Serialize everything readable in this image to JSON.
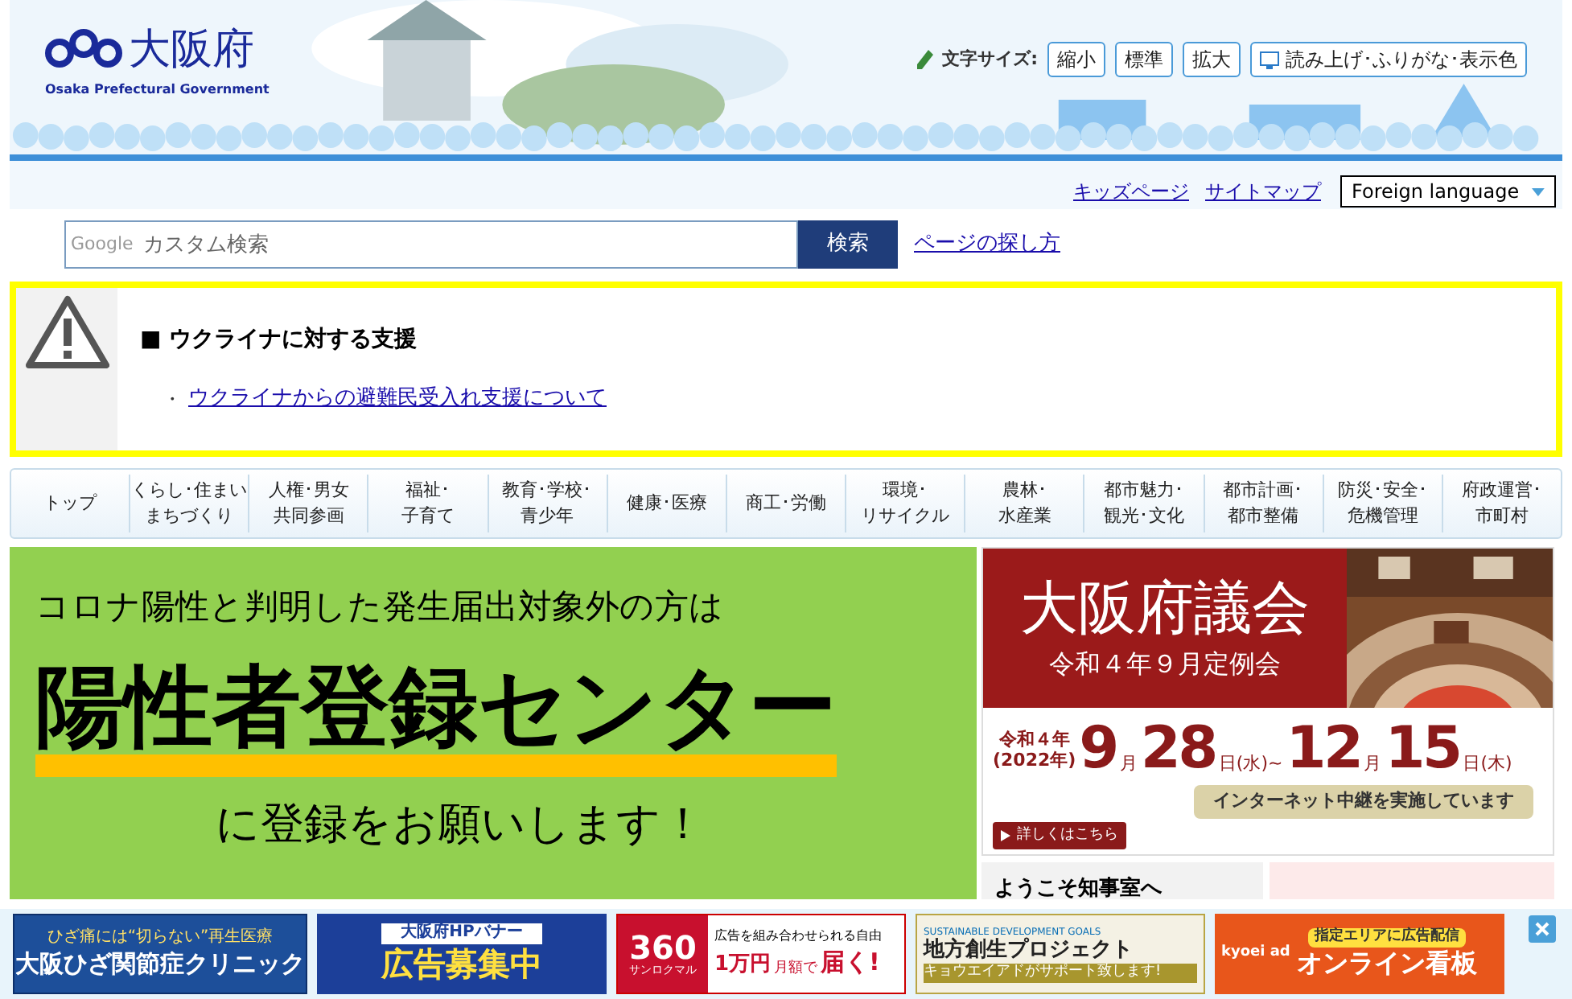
{
  "header": {
    "title": "大阪府",
    "subtitle": "Osaka Prefectural Government",
    "font_size_label": "文字サイズ:",
    "font_size_buttons": [
      "縮小",
      "標準",
      "拡大"
    ],
    "reader_button": "読み上げ･ふりがな･表示色"
  },
  "utility_links": [
    "キッズページ",
    "サイトマップ"
  ],
  "language_select": {
    "value": "Foreign language"
  },
  "search": {
    "brand": "Google",
    "placeholder": "カスタム検索",
    "button": "検索",
    "help_link": "ページの探し方"
  },
  "alert": {
    "title": "■ ウクライナに対する支援",
    "bullet": "・",
    "links": [
      "ウクライナからの避難民受入れ支援について"
    ]
  },
  "nav": [
    {
      "lines": [
        "トップ"
      ]
    },
    {
      "lines": [
        "くらし･住まい",
        "まちづくり"
      ]
    },
    {
      "lines": [
        "人権･男女",
        "共同参画"
      ]
    },
    {
      "lines": [
        "福祉･",
        "子育て"
      ]
    },
    {
      "lines": [
        "教育･学校･",
        "青少年"
      ]
    },
    {
      "lines": [
        "健康･医療"
      ]
    },
    {
      "lines": [
        "商工･労働"
      ]
    },
    {
      "lines": [
        "環境･",
        "リサイクル"
      ]
    },
    {
      "lines": [
        "農林･",
        "水産業"
      ]
    },
    {
      "lines": [
        "都市魅力･",
        "観光･文化"
      ]
    },
    {
      "lines": [
        "都市計画･",
        "都市整備"
      ]
    },
    {
      "lines": [
        "防災･安全･",
        "危機管理"
      ]
    },
    {
      "lines": [
        "府政運営･",
        "市町村"
      ]
    }
  ],
  "covid_banner": {
    "lines": [
      "コロナ陽性と判明した発生届出対象外の方は",
      "陽性者登録センター",
      "に登録をお願いします！"
    ]
  },
  "assembly_banner": {
    "title": "大阪府議会",
    "subtitle": "令和４年９月定例会",
    "era": "令和４年",
    "year": "(2022年)",
    "date_parts": [
      {
        "text": "9",
        "kind": "big"
      },
      {
        "text": "月",
        "kind": "small"
      },
      {
        "text": "28",
        "kind": "big"
      },
      {
        "text": "日(水)~",
        "kind": "small"
      },
      {
        "text": "12",
        "kind": "big"
      },
      {
        "text": "月",
        "kind": "small"
      },
      {
        "text": "15",
        "kind": "big"
      },
      {
        "text": "日(木)",
        "kind": "small"
      }
    ],
    "notice": "インターネット中継を実施しています",
    "details_button": "詳しくはこちら"
  },
  "governor_box": {
    "title": "ようこそ知事室へ"
  },
  "ads": [
    {
      "kind": "clinic",
      "lines": [
        "ひざ痛には“切らない”再生医療",
        "大阪ひざ関節症クリニック"
      ]
    },
    {
      "kind": "recruit",
      "lines": [
        "大阪府HPバナー",
        "広告募集中"
      ]
    },
    {
      "kind": "sanroku",
      "lines": [
        "360",
        "サンロクマル",
        "広告を組み合わせられる自由",
        "1万円",
        "月額で",
        "届く!"
      ]
    },
    {
      "kind": "sdgs",
      "lines": [
        "SUSTAINABLE DEVELOPMENT GOALS",
        "地方創生プロジェクト",
        "キョウエイアドがサポート致します!"
      ]
    },
    {
      "kind": "kyoei",
      "lines": [
        "kyoei ad",
        "指定エリアに広告配信",
        "オンライン看板"
      ]
    }
  ]
}
